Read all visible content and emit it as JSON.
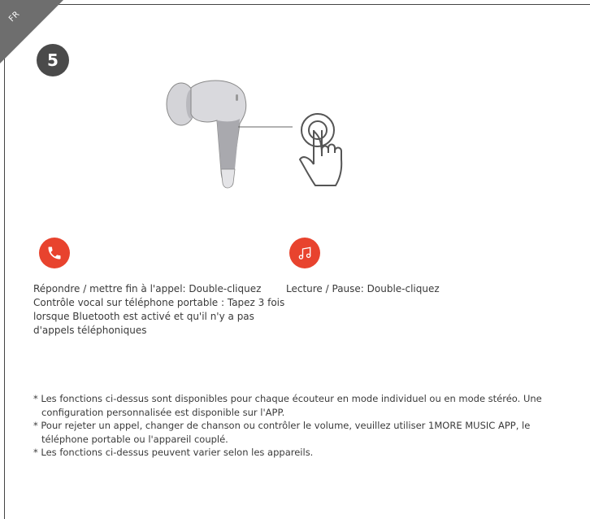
{
  "language_tab": "FR",
  "step_number": "5",
  "gestures": {
    "call": {
      "icon": "phone-icon",
      "line1": "Répondre / mettre fin à l'appel: Double-cliquez",
      "line2": "Contrôle vocal sur téléphone portable : Tapez 3 fois lorsque Bluetooth est activé et qu'il n'y a pas d'appels téléphoniques"
    },
    "music": {
      "icon": "music-note-icon",
      "line1": "Lecture / Pause: Double-cliquez"
    }
  },
  "notes": [
    "* Les fonctions ci-dessus sont disponibles pour chaque écouteur en mode individuel ou en mode stéréo. Une configuration personnalisée est disponible sur l'APP.",
    "* Pour rejeter un appel, changer de chanson ou contrôler le volume, veuillez utiliser 1MORE MUSIC APP, le téléphone portable ou l'appareil couplé.",
    "* Les fonctions ci-dessus peuvent varier selon les appareils."
  ],
  "colors": {
    "accent": "#e8432e",
    "dark": "#4a4a4a",
    "tab": "#6e6e6e"
  }
}
